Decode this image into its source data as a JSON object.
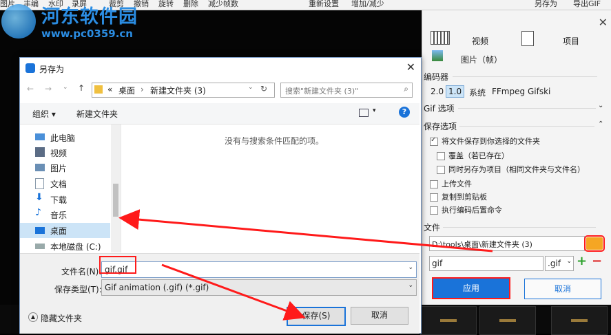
{
  "app": {
    "toolbar": [
      "图片",
      "丰编",
      "水印",
      "录屏",
      "裁剪",
      "撤销",
      "旋转",
      "删除",
      "减少帧数",
      "重新设置",
      "增加/减少",
      "另存为",
      "导出GIF"
    ]
  },
  "watermark": {
    "title": "河东软件园",
    "url": "www.pc0359.cn"
  },
  "right_panel": {
    "media_video": "视频",
    "media_project": "项目",
    "media_images": "图片（帧）",
    "encoder_header": "编码器",
    "encoder_options": [
      "2.0",
      "1.0",
      "系统",
      "FFmpeg",
      "Gifski"
    ],
    "encoder_selected": "1.0",
    "gif_options_header": "Gif 选项",
    "save_options_header": "保存选项",
    "opt_save_to_folder": "将文件保存到你选择的文件夹",
    "opt_overwrite": "覆盖（若已存在）",
    "opt_save_as_project": "同时另存为项目（相同文件夹与文件名）",
    "opt_upload": "上传文件",
    "opt_copy_clipboard": "复制到剪贴板",
    "opt_run_after": "执行编码后置命令",
    "file_header": "文件",
    "folder_path": "D:\\tools\\桌面\\新建文件夹 (3)",
    "filename": "gif",
    "extension": ".gif",
    "apply_label": "应用",
    "cancel_label": "取消"
  },
  "dialog": {
    "title": "另存为",
    "breadcrumb": [
      "«",
      "桌面",
      "›",
      "新建文件夹 (3)"
    ],
    "search_placeholder": "搜索\"新建文件夹 (3)\"",
    "organize_label": "组织 ▾",
    "new_folder_label": "新建文件夹",
    "empty_message": "没有与搜索条件匹配的项。",
    "nav_items": [
      "此电脑",
      "视频",
      "图片",
      "文档",
      "下载",
      "音乐",
      "桌面",
      "本地磁盘 (C:)"
    ],
    "nav_selected": "桌面",
    "filename_label": "文件名(N):",
    "filename_value": "gif.gif",
    "filetype_label": "保存类型(T):",
    "filetype_value": "Gif animation (.gif) (*.gif)",
    "hide_folders_label": "隐藏文件夹",
    "save_label": "保存(S)",
    "cancel_label": "取消"
  },
  "colors": {
    "accent": "#1a73d9",
    "arrow": "#ff1a1a",
    "folder_highlight": "#f5a623",
    "selection": "#cce4f7"
  }
}
